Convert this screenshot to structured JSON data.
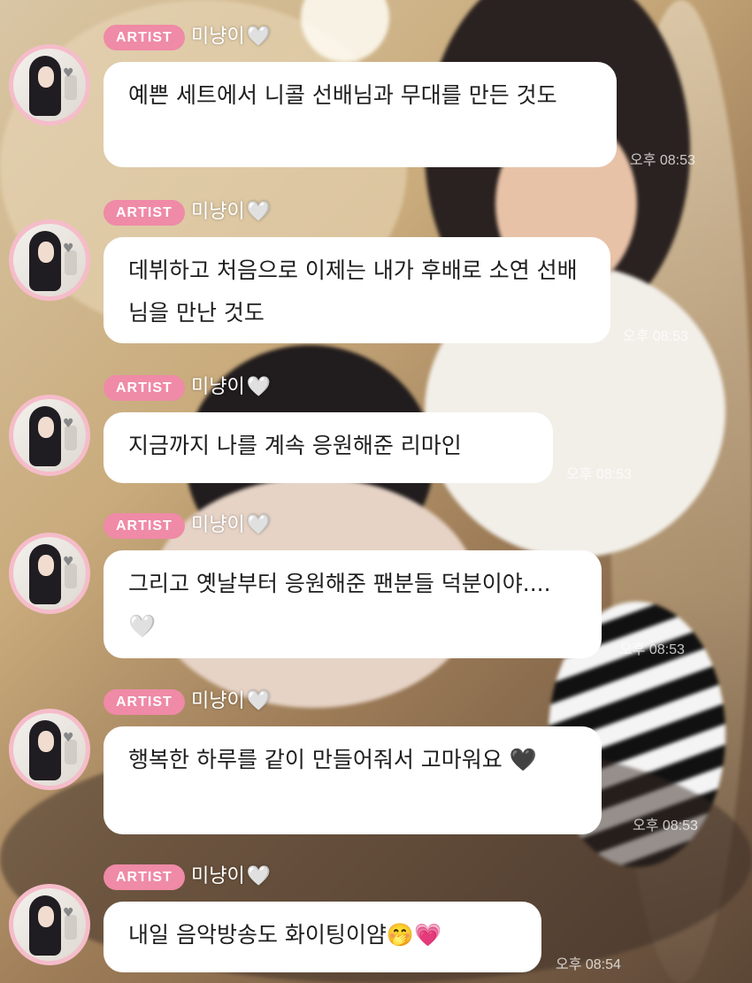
{
  "messages": [
    {
      "badge": "ARTIST",
      "name": "미냥이",
      "name_heart": "🤍",
      "text": "예쁜 세트에서 니콜 선배님과 무대를 만든 것도",
      "time": "오후 08:53"
    },
    {
      "badge": "ARTIST",
      "name": "미냥이",
      "name_heart": "🤍",
      "text": "데뷔하고 처음으로 이제는 내가 후배로 소연 선배님을 만난 것도",
      "time": "오후 08:53"
    },
    {
      "badge": "ARTIST",
      "name": "미냥이",
      "name_heart": "🤍",
      "text": "지금까지 나를 계속 응원해준 리마인",
      "time": "오후 08:53"
    },
    {
      "badge": "ARTIST",
      "name": "미냥이",
      "name_heart": "🤍",
      "text": "그리고 옛날부터 응원해준 팬분들 덕분이야....🤍",
      "time": "오후 08:53"
    },
    {
      "badge": "ARTIST",
      "name": "미냥이",
      "name_heart": "🤍",
      "text": "행복한 하루를 같이 만들어줘서 고마워요 🖤",
      "time": "오후 08:53"
    },
    {
      "badge": "ARTIST",
      "name": "미냥이",
      "name_heart": "🤍",
      "text": "내일 음악방송도 화이팅이얌🤭💗",
      "time": "오후 08:54"
    }
  ],
  "colors": {
    "badge": "#ef8aa7",
    "avatar_ring": "#f5bcc9",
    "bubble": "#ffffff",
    "text": "#1e1e1e"
  },
  "icons": {
    "avatar": "profile-photo",
    "heart": "white-heart-icon"
  }
}
